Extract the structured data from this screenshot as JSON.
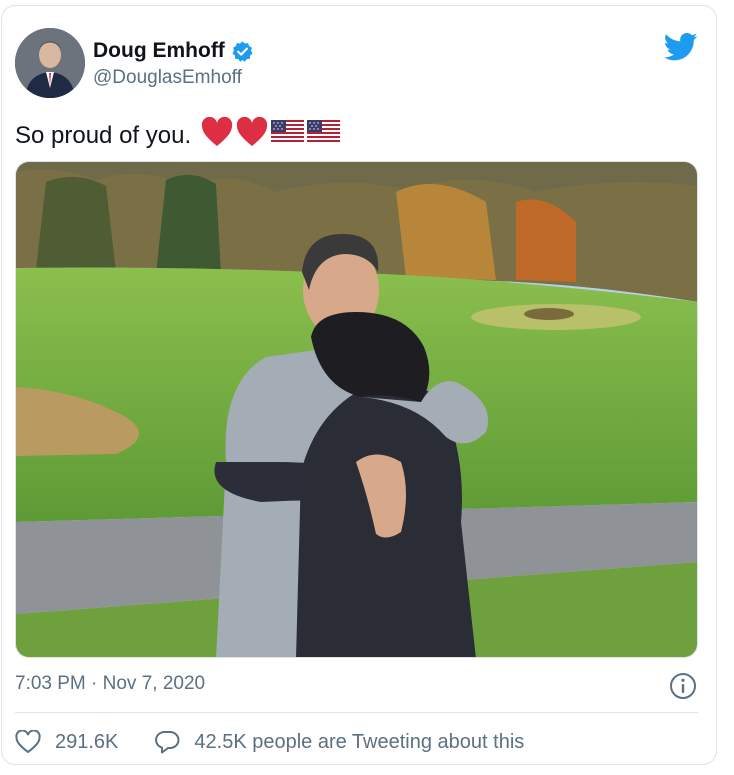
{
  "tweet": {
    "author_name": "Doug Emhoff",
    "author_handle": "@DouglasEmhoff",
    "text": "So proud of you.",
    "emojis": [
      "red-heart",
      "red-heart",
      "us-flag",
      "us-flag"
    ],
    "timestamp": "7:03 PM · Nov 7, 2020",
    "likes": "291.6K",
    "replies_text": "42.5K people are Tweeting about this"
  },
  "icons": {
    "verified": "verified-badge-icon",
    "brand": "twitter-bird-icon",
    "info": "info-icon",
    "like": "heart-outline-icon",
    "reply": "speech-bubble-icon"
  },
  "colors": {
    "brand_blue": "#1d9bf0",
    "text_primary": "#0f1419",
    "text_secondary": "#5b7083",
    "heart_red": "#e0245e",
    "divider": "#dfe3e6"
  }
}
